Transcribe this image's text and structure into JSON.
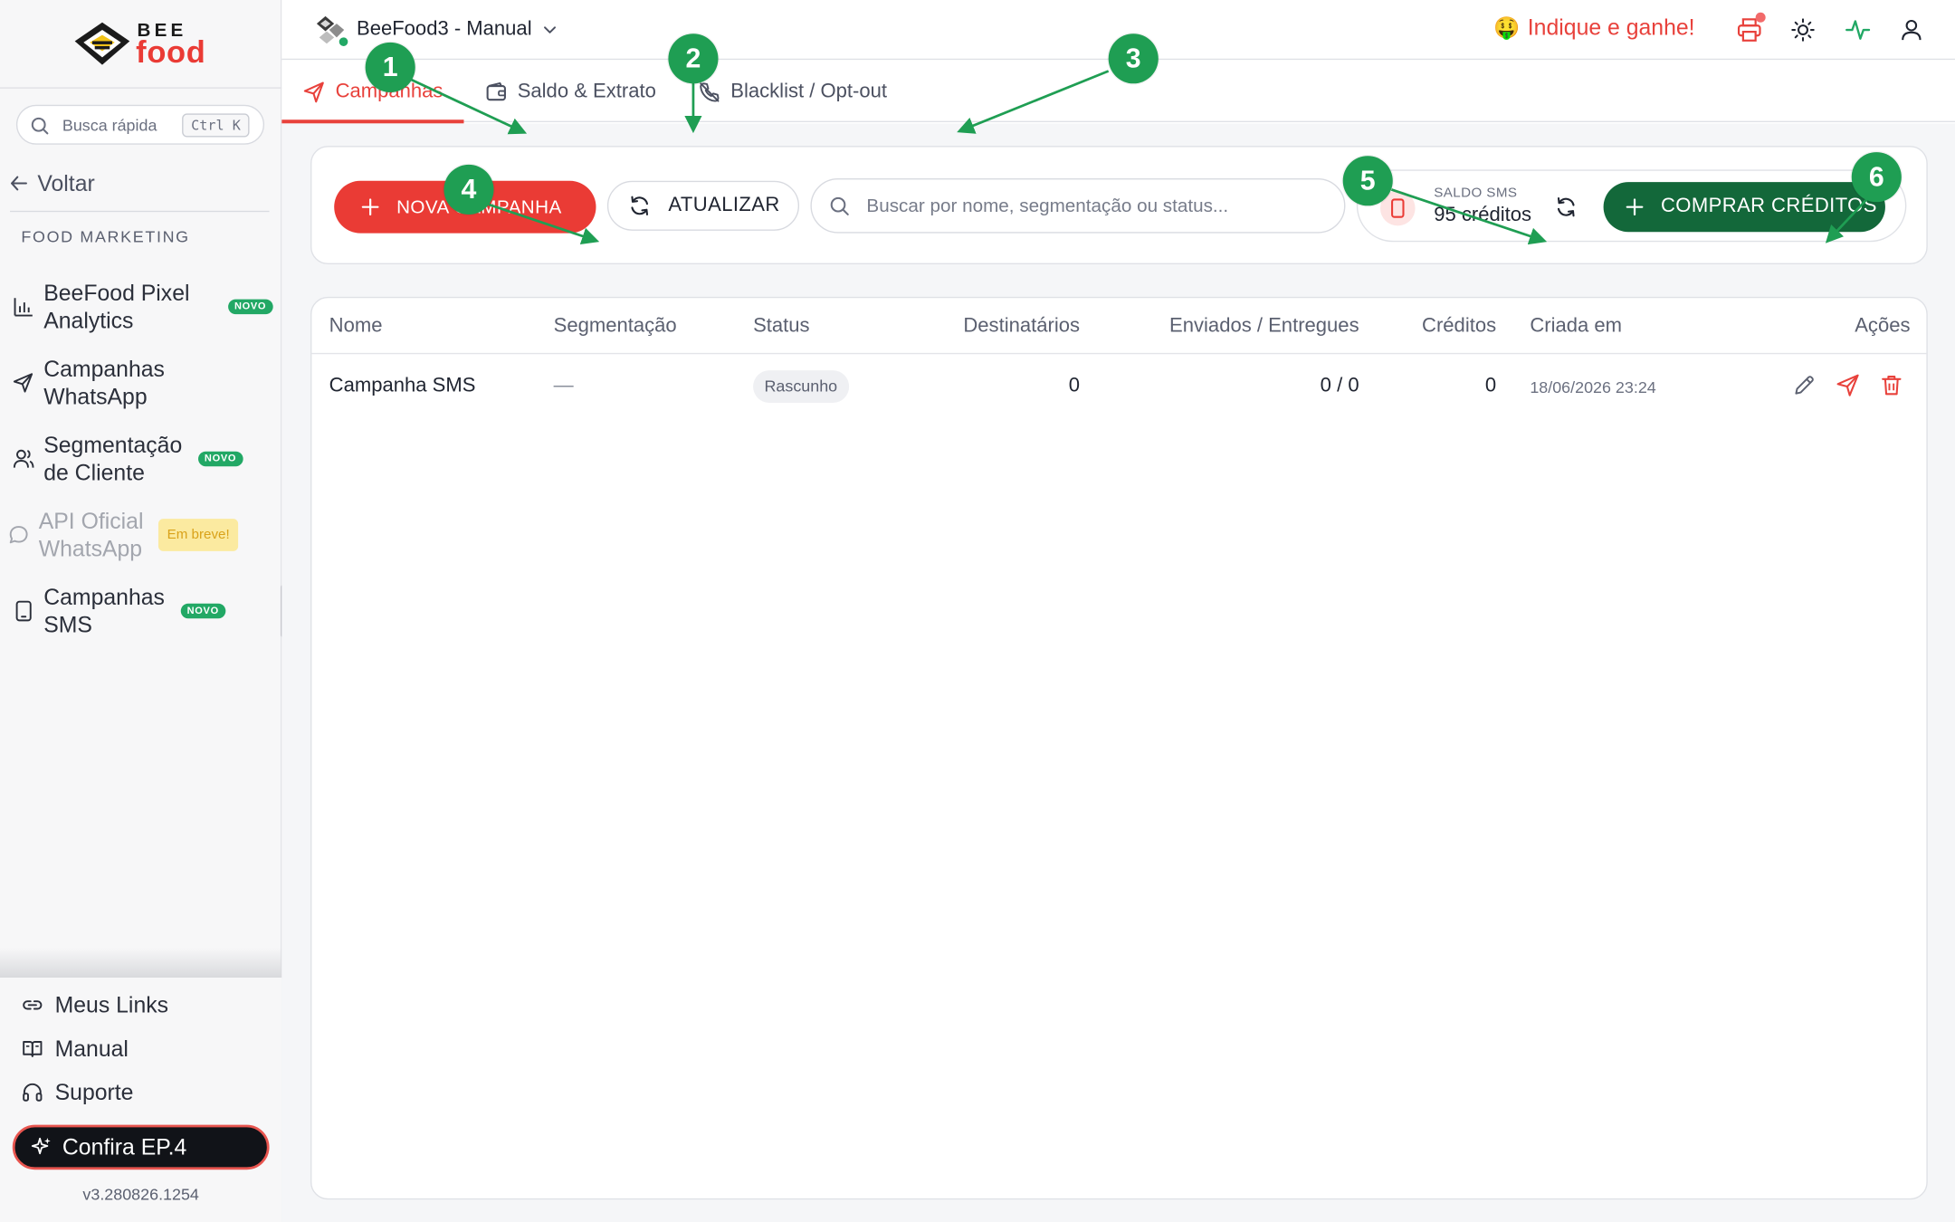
{
  "sidebar": {
    "logo": {
      "line1": "BEE",
      "line2": "food"
    },
    "quick_search": {
      "placeholder": "Busca rápida",
      "shortcut": "Ctrl K"
    },
    "back_label": "Voltar",
    "section_label": "FOOD MARKETING",
    "items": [
      {
        "label": "BeeFood Pixel Analytics",
        "badge": "NOVO",
        "icon": "bar-chart-icon"
      },
      {
        "label": "Campanhas WhatsApp",
        "badge": "",
        "icon": "send-icon"
      },
      {
        "label": "Segmentação de Cliente",
        "badge": "NOVO",
        "icon": "users-icon"
      },
      {
        "label": "API Oficial WhatsApp",
        "badge": "Em breve!",
        "icon": "chat-icon"
      },
      {
        "label": "Campanhas SMS",
        "badge": "NOVO",
        "icon": "phone-icon"
      }
    ],
    "bottom_links": [
      {
        "label": "Meus Links",
        "icon": "link-icon"
      },
      {
        "label": "Manual",
        "icon": "book-icon"
      },
      {
        "label": "Suporte",
        "icon": "headset-icon"
      }
    ],
    "cta_label": "Confira EP.4",
    "version": "v3.280826.1254"
  },
  "header": {
    "store_name": "BeeFood3 - Manual",
    "referral_label": "Indique e ganhe!",
    "referral_emoji": "🤑"
  },
  "tabs": [
    {
      "label": "Campanhas",
      "active": true
    },
    {
      "label": "Saldo & Extrato",
      "active": false
    },
    {
      "label": "Blacklist / Opt-out",
      "active": false
    }
  ],
  "toolbar": {
    "new_campaign_label": "NOVA CAMPANHA",
    "refresh_label": "ATUALIZAR",
    "search_placeholder": "Buscar por nome, segmentação ou status...",
    "balance_label": "SALDO SMS",
    "balance_value": "95 créditos",
    "buy_credits_label": "COMPRAR CRÉDITOS"
  },
  "table": {
    "columns": [
      "Nome",
      "Segmentação",
      "Status",
      "Destinatários",
      "Enviados / Entregues",
      "Créditos",
      "Criada em",
      "Ações"
    ],
    "rows": [
      {
        "name": "Campanha SMS",
        "segment": "—",
        "status": "Rascunho",
        "recipients": "0",
        "sent_delivered": "0 / 0",
        "credits": "0",
        "created_at": "18/06/2026 23:24"
      }
    ]
  },
  "annotations": [
    "1",
    "2",
    "3",
    "4",
    "5",
    "6"
  ],
  "colors": {
    "brand_red": "#ea3b35",
    "brand_green": "#13683a",
    "annotation_green": "#1f9e53",
    "badge_green": "#22a865"
  }
}
